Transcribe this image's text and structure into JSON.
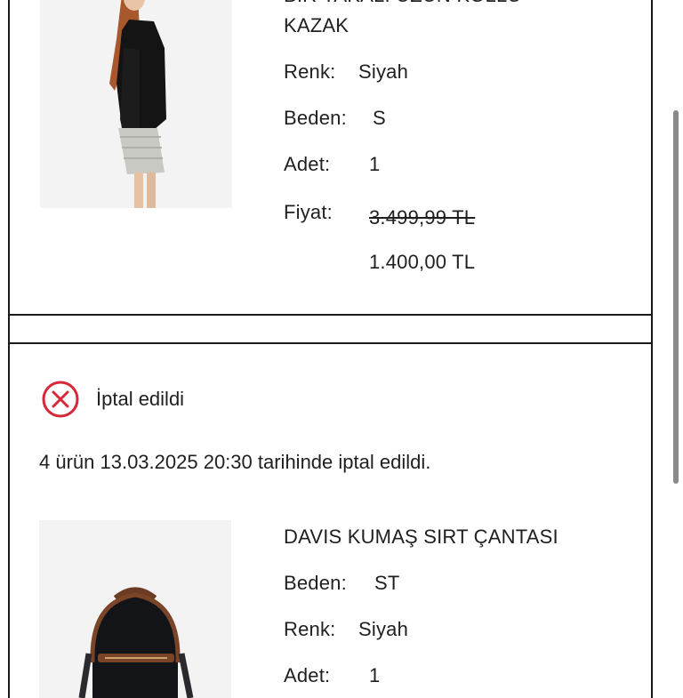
{
  "order_item_1": {
    "title_line1": "BİR YAKALI UZUN KOLLU",
    "title_line2": "KAZAK",
    "color_label": "Renk:",
    "color_value": "Siyah",
    "size_label": "Beden:",
    "size_value": "S",
    "qty_label": "Adet:",
    "qty_value": "1",
    "price_label": "Fiyat:",
    "price_old": "3.499,99 TL",
    "price_new": "1.400,00 TL"
  },
  "cancel_section": {
    "status_text": "İptal edildi",
    "note": "4 ürün 13.03.2025 20:30 tarihinde iptal edildi.",
    "status_color": "#d62839"
  },
  "order_item_2": {
    "title": "DAVIS KUMAŞ SIRT ÇANTASI",
    "size_label": "Beden:",
    "size_value": "ST",
    "color_label": "Renk:",
    "color_value": "Siyah",
    "qty_label": "Adet:",
    "qty_value": "1"
  }
}
